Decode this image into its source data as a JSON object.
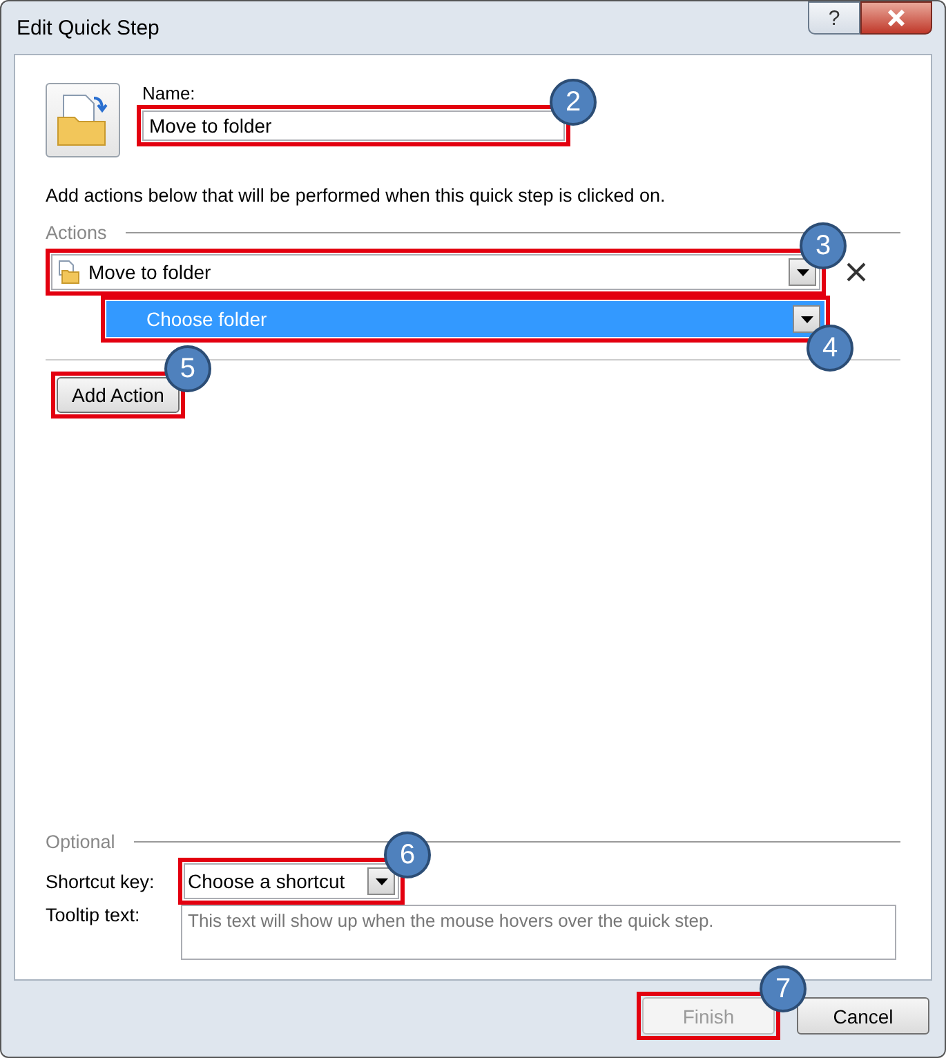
{
  "window": {
    "title": "Edit Quick Step",
    "help_label": "?"
  },
  "name_field": {
    "label": "Name:",
    "value": "Move to folder",
    "callout": "2"
  },
  "instructions": "Add actions below that will be performed when this quick step is clicked on.",
  "actions_section": {
    "heading": "Actions",
    "actions": [
      {
        "kind": "action",
        "value": "Move to folder",
        "selected": false,
        "callout": "3"
      },
      {
        "kind": "parameter",
        "value": "Choose folder",
        "selected": true,
        "callout": "4"
      }
    ]
  },
  "add_action_button": {
    "label": "Add Action",
    "callout": "5"
  },
  "optional": {
    "heading": "Optional",
    "shortcut": {
      "label": "Shortcut key:",
      "value": "Choose a shortcut",
      "callout": "6"
    },
    "tooltip": {
      "label": "Tooltip text:",
      "placeholder": "This text will show up when the mouse hovers over the quick step."
    }
  },
  "buttons": [
    {
      "label": "Finish",
      "disabled": true,
      "callout": "7"
    },
    {
      "label": "Cancel",
      "disabled": false
    }
  ]
}
